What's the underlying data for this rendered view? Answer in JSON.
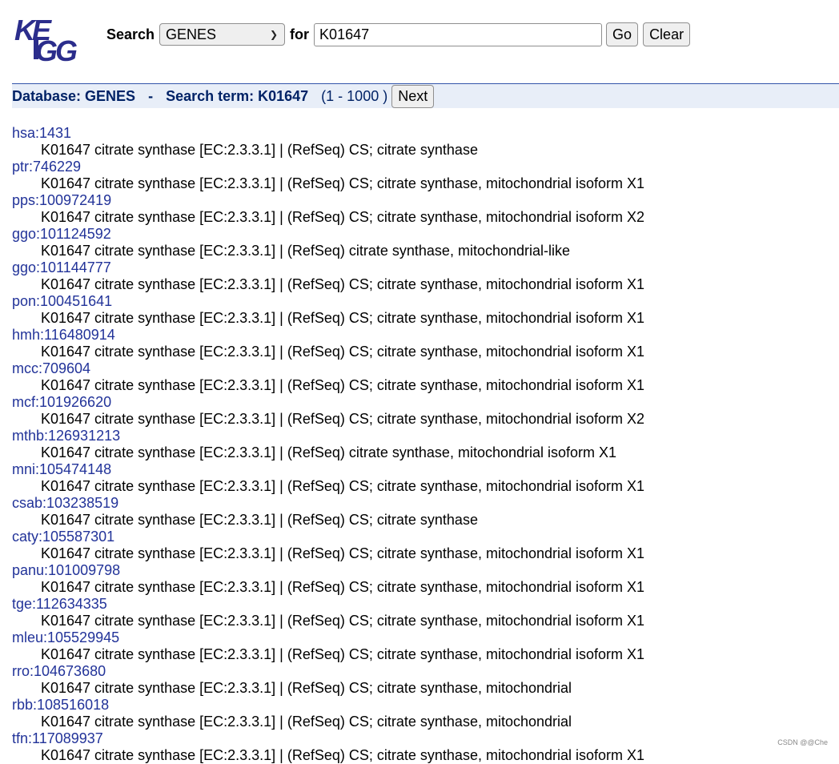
{
  "search": {
    "label_search": "Search",
    "db_selected": "GENES",
    "label_for": "for",
    "query": "K01647",
    "go_label": "Go",
    "clear_label": "Clear"
  },
  "dbbar": {
    "db": "Database: GENES",
    "sep": "-",
    "term": "Search term: K01647",
    "range": "(1 - 1000 )",
    "next_label": "Next"
  },
  "results": [
    {
      "id": "hsa:1431",
      "desc": "K01647 citrate synthase [EC:2.3.3.1] | (RefSeq) CS; citrate synthase"
    },
    {
      "id": "ptr:746229",
      "desc": "K01647 citrate synthase [EC:2.3.3.1] | (RefSeq) CS; citrate synthase, mitochondrial isoform X1"
    },
    {
      "id": "pps:100972419",
      "desc": "K01647 citrate synthase [EC:2.3.3.1] | (RefSeq) CS; citrate synthase, mitochondrial isoform X2"
    },
    {
      "id": "ggo:101124592",
      "desc": "K01647 citrate synthase [EC:2.3.3.1] | (RefSeq) citrate synthase, mitochondrial-like"
    },
    {
      "id": "ggo:101144777",
      "desc": "K01647 citrate synthase [EC:2.3.3.1] | (RefSeq) CS; citrate synthase, mitochondrial isoform X1"
    },
    {
      "id": "pon:100451641",
      "desc": "K01647 citrate synthase [EC:2.3.3.1] | (RefSeq) CS; citrate synthase, mitochondrial isoform X1"
    },
    {
      "id": "hmh:116480914",
      "desc": "K01647 citrate synthase [EC:2.3.3.1] | (RefSeq) CS; citrate synthase, mitochondrial isoform X1"
    },
    {
      "id": "mcc:709604",
      "desc": "K01647 citrate synthase [EC:2.3.3.1] | (RefSeq) CS; citrate synthase, mitochondrial isoform X1"
    },
    {
      "id": "mcf:101926620",
      "desc": "K01647 citrate synthase [EC:2.3.3.1] | (RefSeq) CS; citrate synthase, mitochondrial isoform X2"
    },
    {
      "id": "mthb:126931213",
      "desc": "K01647 citrate synthase [EC:2.3.3.1] | (RefSeq) citrate synthase, mitochondrial isoform X1"
    },
    {
      "id": "mni:105474148",
      "desc": "K01647 citrate synthase [EC:2.3.3.1] | (RefSeq) CS; citrate synthase, mitochondrial isoform X1"
    },
    {
      "id": "csab:103238519",
      "desc": "K01647 citrate synthase [EC:2.3.3.1] | (RefSeq) CS; citrate synthase"
    },
    {
      "id": "caty:105587301",
      "desc": "K01647 citrate synthase [EC:2.3.3.1] | (RefSeq) CS; citrate synthase, mitochondrial isoform X1"
    },
    {
      "id": "panu:101009798",
      "desc": "K01647 citrate synthase [EC:2.3.3.1] | (RefSeq) CS; citrate synthase, mitochondrial isoform X1"
    },
    {
      "id": "tge:112634335",
      "desc": "K01647 citrate synthase [EC:2.3.3.1] | (RefSeq) CS; citrate synthase, mitochondrial isoform X1"
    },
    {
      "id": "mleu:105529945",
      "desc": "K01647 citrate synthase [EC:2.3.3.1] | (RefSeq) CS; citrate synthase, mitochondrial isoform X1"
    },
    {
      "id": "rro:104673680",
      "desc": "K01647 citrate synthase [EC:2.3.3.1] | (RefSeq) CS; citrate synthase, mitochondrial"
    },
    {
      "id": "rbb:108516018",
      "desc": "K01647 citrate synthase [EC:2.3.3.1] | (RefSeq) CS; citrate synthase, mitochondrial"
    },
    {
      "id": "tfn:117089937",
      "desc": "K01647 citrate synthase [EC:2.3.3.1] | (RefSeq) CS; citrate synthase, mitochondrial isoform X1"
    }
  ],
  "logo_text": "KEGG",
  "watermark": "CSDN @@Che",
  "colors": {
    "link": "#223399",
    "bar_bg": "#e8eef8",
    "bar_text": "#002266",
    "logo": "#2b2d8c"
  }
}
